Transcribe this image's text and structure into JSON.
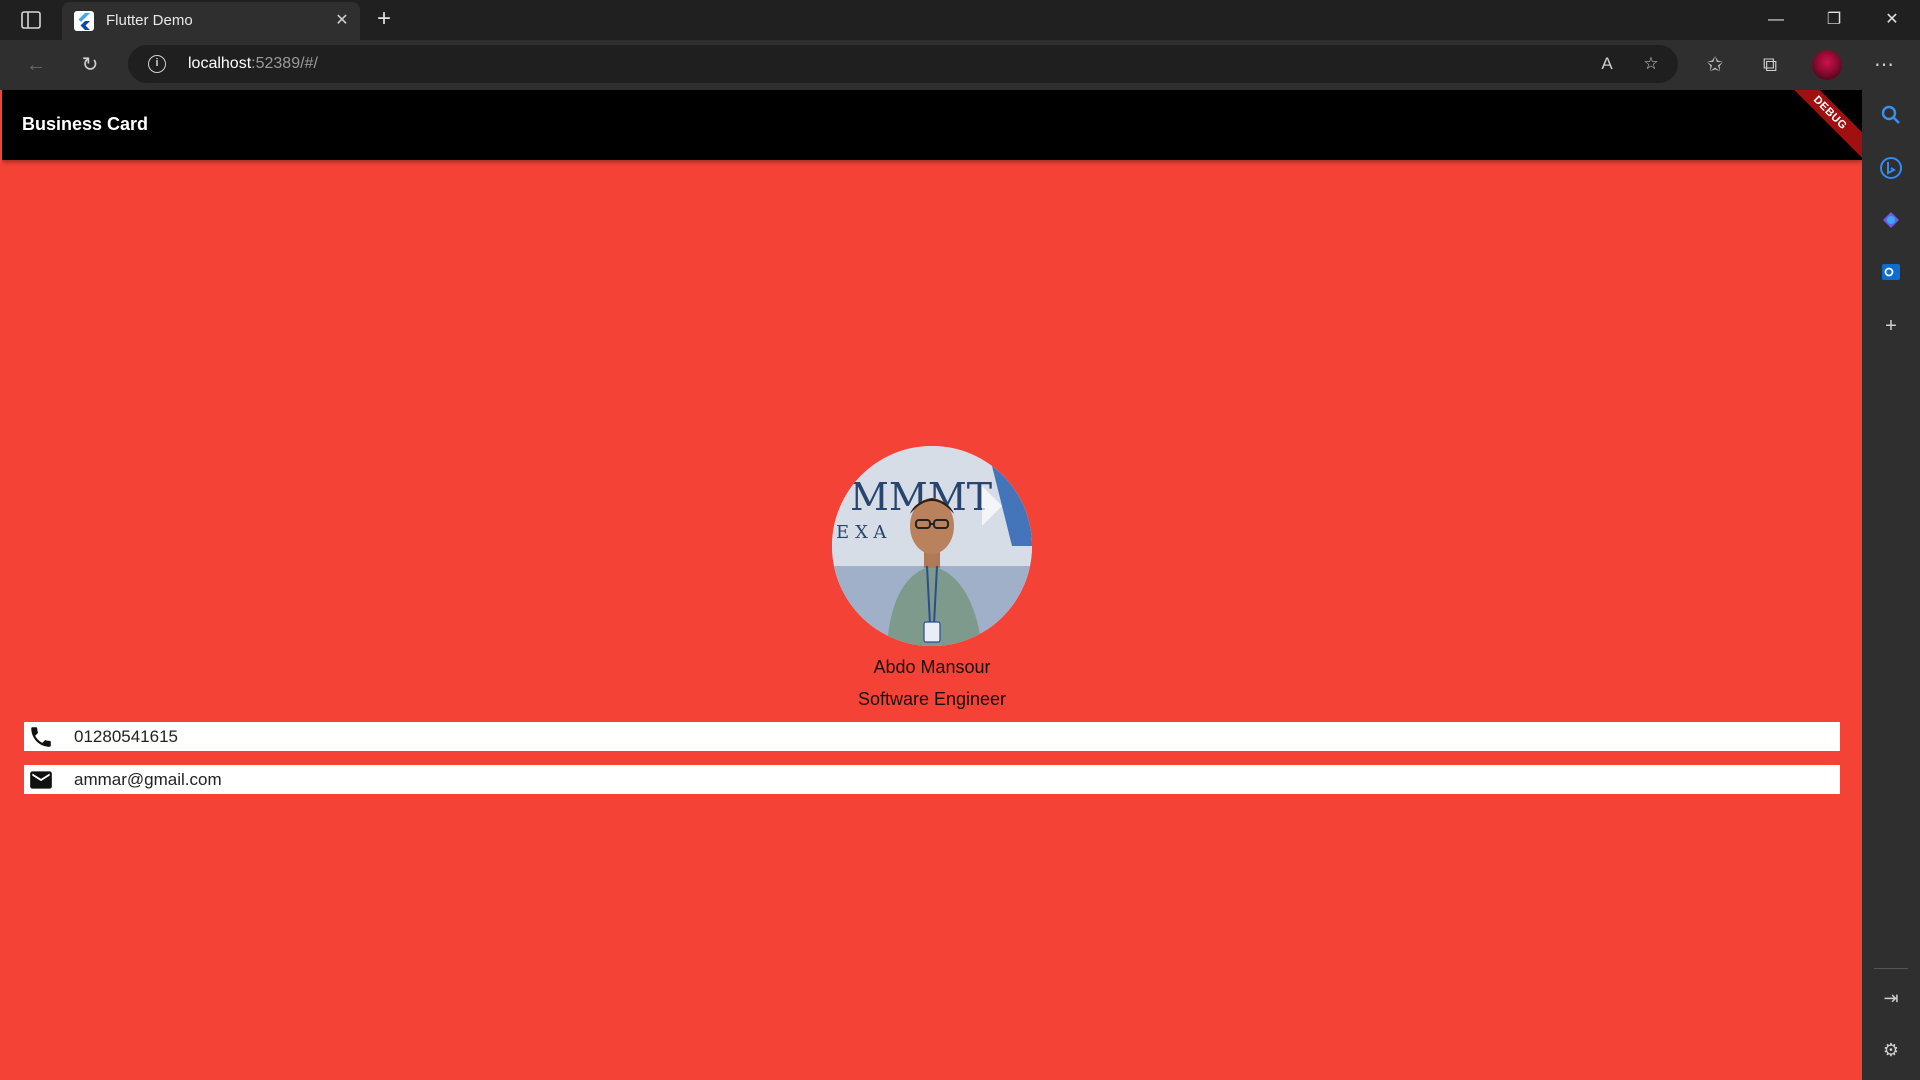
{
  "browser": {
    "tab_title": "Flutter Demo",
    "address_host": "localhost",
    "address_rest": ":52389/#/"
  },
  "app": {
    "appbar_title": "Business Card",
    "debug_label": "DEBUG",
    "name": "Abdo Mansour",
    "job_title": "Software Engineer",
    "contacts": [
      {
        "icon": "phone-icon",
        "value": "01280541615"
      },
      {
        "icon": "mail-icon",
        "value": "ammar@gmail.com"
      }
    ],
    "profile_photo": {
      "alt": "profile photo",
      "backdrop_text_1": "MMMT",
      "backdrop_text_2": "EXA"
    }
  },
  "colors": {
    "background": "#f44336",
    "appbar": "#000000",
    "card": "#ffffff"
  }
}
